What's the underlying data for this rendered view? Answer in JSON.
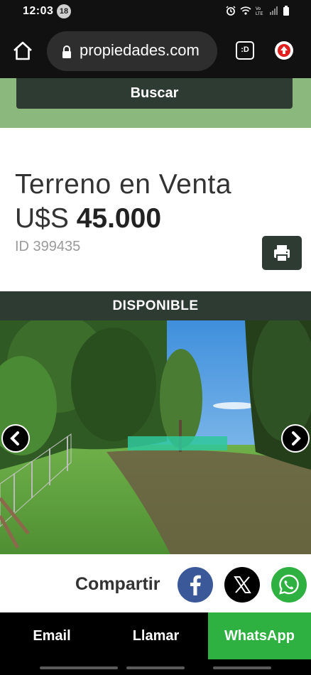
{
  "status_bar": {
    "time": "12:03",
    "notification_count": "18",
    "icons": [
      "alarm-icon",
      "wifi-icon",
      "lte-icon",
      "signal-icon",
      "battery-icon"
    ]
  },
  "browser": {
    "url": "propiedades.com",
    "tab_label": ":D",
    "icons": [
      "home-icon",
      "lock-icon",
      "tab-switcher-icon",
      "extension-icon"
    ]
  },
  "search": {
    "button_label": "Buscar"
  },
  "listing": {
    "title": "Terreno en Venta",
    "currency": "U$S",
    "price": "45.000",
    "id_label": "ID 399435",
    "status": "DISPONIBLE"
  },
  "gallery": {
    "prev_icon": "chevron-left-icon",
    "next_icon": "chevron-right-icon"
  },
  "share": {
    "label": "Compartir",
    "networks": [
      {
        "name": "facebook",
        "icon": "facebook-icon",
        "color": "#3b5998"
      },
      {
        "name": "x",
        "icon": "x-icon",
        "color": "#000000"
      },
      {
        "name": "whatsapp",
        "icon": "whatsapp-icon",
        "color": "#2fb141"
      }
    ]
  },
  "actions": {
    "email": "Email",
    "call": "Llamar",
    "whatsapp": "WhatsApp",
    "whatsapp_color": "#2fb141"
  },
  "colors": {
    "dark_green": "#2d3b33",
    "light_green": "#8ab87d"
  }
}
